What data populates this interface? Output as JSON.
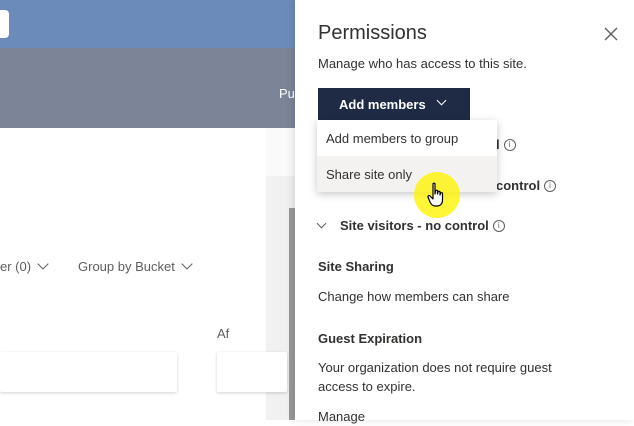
{
  "background": {
    "top_right_text": "Pu",
    "filter_label": "er (0)",
    "group_label": "Group by Bucket",
    "after_label": "Af"
  },
  "panel": {
    "title": "Permissions",
    "subtitle": "Manage who has access to this site.",
    "add_members_label": "Add members",
    "row1_partial": "l",
    "row2_partial": "control",
    "site_visitors_label": "Site visitors - no control",
    "site_sharing_heading": "Site Sharing",
    "site_sharing_link": "Change how members can share",
    "guest_expiration_heading": "Guest Expiration",
    "guest_expiration_text_line1": "Your organization does not require guest",
    "guest_expiration_text_line2": "access to expire.",
    "manage_link": "Manage"
  },
  "dropdown": {
    "items": [
      {
        "label": "Add members to group"
      },
      {
        "label": "Share site only"
      }
    ]
  },
  "colors": {
    "header_blue": "#6b8cba",
    "band_grey": "#7b8597",
    "button_navy": "#1f2a44",
    "cursor_highlight": "#fff300"
  }
}
